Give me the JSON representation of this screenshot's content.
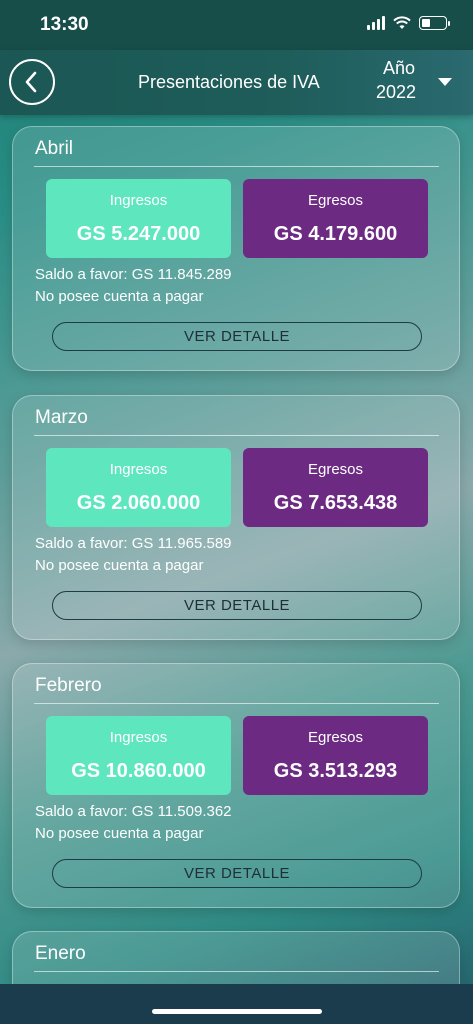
{
  "status_bar": {
    "time": "13:30"
  },
  "header": {
    "title": "Presentaciones de IVA",
    "year_label": "Año",
    "year_value": "2022"
  },
  "months": [
    {
      "name": "Abril",
      "income_label": "Ingresos",
      "income_value": "GS 5.247.000",
      "expense_label": "Egresos",
      "expense_value": "GS 4.179.600",
      "balance": "Saldo a favor: GS 11.845.289",
      "payable": "No posee cuenta a pagar",
      "detail_label": "VER DETALLE"
    },
    {
      "name": "Marzo",
      "income_label": "Ingresos",
      "income_value": "GS 2.060.000",
      "expense_label": "Egresos",
      "expense_value": "GS 7.653.438",
      "balance": "Saldo a favor: GS 11.965.589",
      "payable": "No posee cuenta a pagar",
      "detail_label": "VER DETALLE"
    },
    {
      "name": "Febrero",
      "income_label": "Ingresos",
      "income_value": "GS 10.860.000",
      "expense_label": "Egresos",
      "expense_value": "GS 3.513.293",
      "balance": "Saldo a favor: GS 11.509.362",
      "payable": "No posee cuenta a pagar",
      "detail_label": "VER DETALLE"
    },
    {
      "name": "Enero"
    }
  ],
  "colors": {
    "income": "#5ee6be",
    "expense": "#6c2a82",
    "header": "#1b5754"
  }
}
